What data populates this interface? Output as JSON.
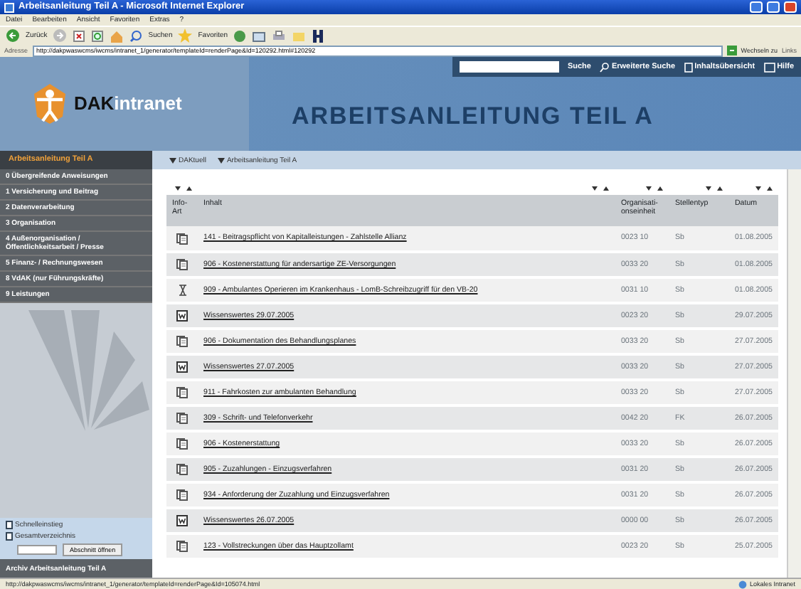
{
  "window": {
    "title": "Arbeitsanleitung Teil A - Microsoft Internet Explorer"
  },
  "menu": [
    "Datei",
    "Bearbeiten",
    "Ansicht",
    "Favoriten",
    "Extras",
    "?"
  ],
  "toolbar": {
    "back": "Zurück",
    "search": "Suchen",
    "favorites": "Favoriten"
  },
  "address": {
    "label": "Adresse",
    "value": "http://dakpwaswcms/iwcms/intranet_1/generator/templateId=renderPage&Id=120292.html#120292",
    "go": "Wechseln zu",
    "links": "Links"
  },
  "header": {
    "logo_a": "DAK",
    "logo_b": "intranet",
    "search_button": "Suche",
    "links": [
      "Erweiterte Suche",
      "Inhaltsübersicht",
      "Hilfe"
    ],
    "page_title": "ARBEITSANLEITUNG TEIL A"
  },
  "breadcrumb": [
    "DAKtuell",
    "Arbeitsanleitung Teil A"
  ],
  "sidebar": {
    "title": "Arbeitsanleitung Teil A",
    "items": [
      {
        "label": "0 Übergreifende Anweisungen",
        "selected": false
      },
      {
        "label": "1 Versicherung und Beitrag",
        "selected": false
      },
      {
        "label": "2 Datenverarbeitung",
        "selected": false
      },
      {
        "label": "3 Organisation",
        "selected": false
      },
      {
        "label": "4 Außenorganisation / Öffentlichkeitsarbeit / Presse",
        "selected": false
      },
      {
        "label": "5 Finanz- / Rechnungswesen",
        "selected": false
      },
      {
        "label": "8 VdAK (nur Führungskräfte)",
        "selected": false
      },
      {
        "label": "9 Leistungen",
        "selected": false
      }
    ],
    "quick_links": [
      "Schnelleinstieg",
      "Gesamtverzeichnis"
    ],
    "open_button": "Abschnitt öffnen",
    "archive": "Archiv Arbeitsanleitung Teil A"
  },
  "table": {
    "columns": [
      "Info-Art",
      "Inhalt",
      "Organisati-onseinheit",
      "Stellentyp",
      "Datum"
    ],
    "rows": [
      {
        "kind": "document",
        "title": "141 - Beitragspflicht von Kapitalleistungen - Zahlstelle Allianz",
        "unit": "0023 10",
        "type": "Sb",
        "date": "01.08.2005"
      },
      {
        "kind": "document",
        "title": "906 - Kostenerstattung für andersartige ZE-Versorgungen",
        "unit": "0033 20",
        "type": "Sb",
        "date": "01.08.2005"
      },
      {
        "kind": "pending",
        "title": "909 - Ambulantes Operieren im Krankenhaus - LomB-Schreibzugriff für den VB-20",
        "unit": "0031 10",
        "type": "Sb",
        "date": "01.08.2005"
      },
      {
        "kind": "news",
        "title": "Wissenswertes 29.07.2005",
        "unit": "0023 20",
        "type": "Sb",
        "date": "29.07.2005"
      },
      {
        "kind": "document",
        "title": "906 - Dokumentation des Behandlungsplanes",
        "unit": "0033 20",
        "type": "Sb",
        "date": "27.07.2005"
      },
      {
        "kind": "news",
        "title": "Wissenswertes 27.07.2005",
        "unit": "0033 20",
        "type": "Sb",
        "date": "27.07.2005"
      },
      {
        "kind": "document",
        "title": "911 - Fahrkosten zur ambulanten Behandlung",
        "unit": "0033 20",
        "type": "Sb",
        "date": "27.07.2005"
      },
      {
        "kind": "document",
        "title": "309 - Schrift- und Telefonverkehr",
        "unit": "0042 20",
        "type": "FK",
        "date": "26.07.2005"
      },
      {
        "kind": "document",
        "title": "906 - Kostenerstattung",
        "unit": "0033 20",
        "type": "Sb",
        "date": "26.07.2005"
      },
      {
        "kind": "document",
        "title": "905 - Zuzahlungen - Einzugsverfahren",
        "unit": "0031 20",
        "type": "Sb",
        "date": "26.07.2005"
      },
      {
        "kind": "document",
        "title": "934 - Anforderung der Zuzahlung und Einzugsverfahren",
        "unit": "0031 20",
        "type": "Sb",
        "date": "26.07.2005"
      },
      {
        "kind": "news",
        "title": "Wissenswertes 26.07.2005",
        "unit": "0000 00",
        "type": "Sb",
        "date": "26.07.2005"
      },
      {
        "kind": "document",
        "title": "123 - Vollstreckungen über das Hauptzollamt",
        "unit": "0023 20",
        "type": "Sb",
        "date": "25.07.2005"
      }
    ]
  },
  "status_bar": {
    "url": "http://dakpwaswcms/iwcms/intranet_1/generator/templateId=renderPage&Id=105074.html",
    "zone": "Lokales Intranet"
  }
}
